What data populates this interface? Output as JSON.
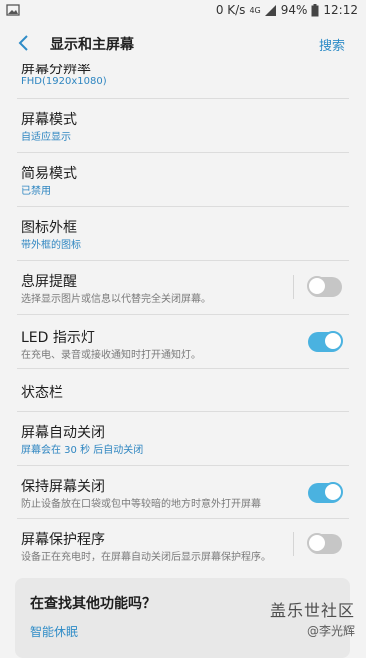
{
  "status_bar": {
    "speed": "0 K/s",
    "network": "4G",
    "battery": "94%",
    "time": "12:12"
  },
  "app_bar": {
    "title": "显示和主屏幕",
    "search": "搜索"
  },
  "settings": {
    "resolution": {
      "title": "屏幕分辨率",
      "value": "FHD(1920x1080)"
    },
    "screen_mode": {
      "title": "屏幕模式",
      "value": "自适应显示"
    },
    "easy_mode": {
      "title": "简易模式",
      "value": "已禁用"
    },
    "icon_frame": {
      "title": "图标外框",
      "value": "带外框的图标"
    },
    "always_on": {
      "title": "息屏提醒",
      "desc": "选择显示图片或信息以代替完全关闭屏幕。",
      "enabled": false
    },
    "led": {
      "title": "LED 指示灯",
      "desc": "在充电、录音或接收通知时打开通知灯。",
      "enabled": true
    },
    "status_bar_item": {
      "title": "状态栏"
    },
    "screen_timeout": {
      "title": "屏幕自动关闭",
      "value": "屏幕会在 30 秒 后自动关闭"
    },
    "keep_screen_off": {
      "title": "保持屏幕关闭",
      "desc": "防止设备放在口袋或包中等较暗的地方时意外打开屏幕",
      "enabled": true
    },
    "screensaver": {
      "title": "屏幕保护程序",
      "desc": "设备正在充电时，在屏幕自动关闭后显示屏幕保护程序。",
      "enabled": false
    }
  },
  "suggestion_card": {
    "title": "在查找其他功能吗？",
    "link": "智能休眠"
  },
  "watermark": {
    "line1": "盖乐世社区",
    "line2": "@李光辉"
  },
  "colors": {
    "accent": "#2f8cc7",
    "toggle_on": "#4ab2e0",
    "toggle_off": "#c6c6c6"
  }
}
